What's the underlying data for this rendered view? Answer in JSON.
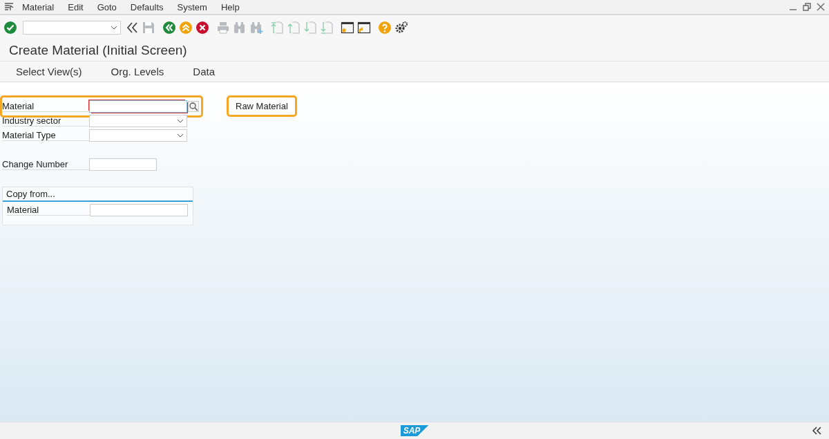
{
  "menu_bar": {
    "items": [
      {
        "label": "Material"
      },
      {
        "label": "Edit"
      },
      {
        "label": "Goto"
      },
      {
        "label": "Defaults"
      },
      {
        "label": "System"
      },
      {
        "label": "Help"
      }
    ]
  },
  "toolbar": {
    "buttons": [
      {
        "kind": "enter",
        "disabled": false
      },
      {
        "kind": "back-double",
        "disabled": false
      },
      {
        "kind": "save",
        "disabled": true
      },
      {
        "kind": "back",
        "disabled": false
      },
      {
        "kind": "exit",
        "disabled": false
      },
      {
        "kind": "cancel",
        "disabled": false
      },
      {
        "kind": "print",
        "disabled": true
      },
      {
        "kind": "find",
        "disabled": true
      },
      {
        "kind": "find-next",
        "disabled": true
      },
      {
        "kind": "first-page",
        "disabled": true
      },
      {
        "kind": "previous-page",
        "disabled": true
      },
      {
        "kind": "next-page",
        "disabled": true
      },
      {
        "kind": "last-page",
        "disabled": true
      },
      {
        "kind": "new-session",
        "disabled": false
      },
      {
        "kind": "shortcut",
        "disabled": false
      },
      {
        "kind": "help",
        "disabled": false
      },
      {
        "kind": "customize",
        "disabled": false
      }
    ]
  },
  "title": "Create Material (Initial Screen)",
  "app_toolbar": [
    {
      "label": "Select View(s)"
    },
    {
      "label": "Org. Levels"
    },
    {
      "label": "Data"
    }
  ],
  "fields": [
    {
      "label": "Material",
      "kind": "text",
      "focused": true,
      "search_help": true,
      "highlighted": true
    },
    {
      "label": "Industry sector",
      "kind": "dropdown",
      "focused": false,
      "search_help": false,
      "highlighted": false
    },
    {
      "label": "Material Type",
      "kind": "dropdown",
      "focused": false,
      "search_help": false,
      "highlighted": false
    },
    {
      "label": "Change Number",
      "kind": "short",
      "focused": false,
      "search_help": false,
      "highlighted": false
    }
  ],
  "callout": "Raw Material",
  "copy_from": {
    "title": "Copy from...",
    "fields": [
      {
        "label": "Material"
      }
    ]
  },
  "status_bar": {
    "logo": "SAP"
  }
}
